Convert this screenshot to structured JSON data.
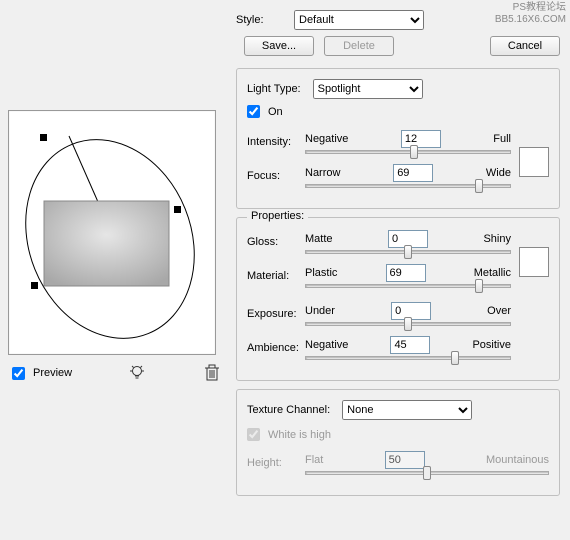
{
  "watermark": {
    "line1": "PS教程论坛",
    "line2": "BB5.16X6.COM"
  },
  "style": {
    "label": "Style:",
    "value": "Default",
    "save": "Save...",
    "delete": "Delete"
  },
  "cancel": "Cancel",
  "lightSection": {
    "typeLabel": "Light Type:",
    "typeValue": "Spotlight",
    "onLabel": "On",
    "onChecked": true,
    "intensity": {
      "label": "Intensity:",
      "left": "Negative",
      "right": "Full",
      "value": "12",
      "pct": 53
    },
    "focus": {
      "label": "Focus:",
      "left": "Narrow",
      "right": "Wide",
      "value": "69",
      "pct": 85
    },
    "swatch": "#ffffff"
  },
  "properties": {
    "title": "Properties:",
    "gloss": {
      "label": "Gloss:",
      "left": "Matte",
      "right": "Shiny",
      "value": "0",
      "pct": 50
    },
    "material": {
      "label": "Material:",
      "left": "Plastic",
      "right": "Metallic",
      "value": "69",
      "pct": 85
    },
    "exposure": {
      "label": "Exposure:",
      "left": "Under",
      "right": "Over",
      "value": "0",
      "pct": 50
    },
    "ambience": {
      "label": "Ambience:",
      "left": "Negative",
      "right": "Positive",
      "value": "45",
      "pct": 73
    },
    "swatch": "#ffffff"
  },
  "texture": {
    "channelLabel": "Texture Channel:",
    "channelValue": "None",
    "whiteHighLabel": "White is high",
    "whiteHighChecked": true,
    "height": {
      "label": "Height:",
      "left": "Flat",
      "right": "Mountainous",
      "value": "50",
      "pct": 50
    }
  },
  "left": {
    "previewLabel": "Preview",
    "previewChecked": true
  }
}
